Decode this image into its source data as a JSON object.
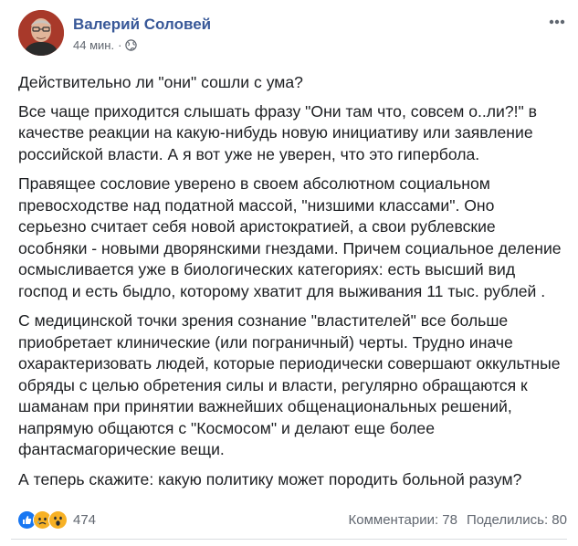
{
  "post": {
    "author": "Валерий Соловей",
    "timestamp": "44 мин.",
    "separator": "·",
    "paragraphs": [
      "Действительно ли \"они\" сошли с ума?",
      "Все чаще приходится слышать фразу \"Они там что, совсем о..ли?!\" в качестве реакции на какую-нибудь новую инициативу или заявление российской власти. А я вот уже не уверен, что это гипербола.",
      "Правящее сословие уверено в своем абсолютном социальном превосходстве над податной массой, \"низшими классами\". Оно серьезно считает себя новой аристократией, а свои рублевские особняки - новыми дворянскими гнездами. Причем социальное деление осмысливается уже в биологических категориях: есть высший вид господ и есть быдло, которому хватит для выживания 11 тыс. рублей .",
      "С медицинской точки зрения сознание \"властителей\" все больше приобретает клинические (или пограничный) черты. Трудно иначе охарактеризовать людей, которые периодически совершают оккультные обряды с целью обретения силы и власти, регулярно обращаются к шаманам при принятии важнейших общенациональных решений, напрямую общаются с \"Космосом\" и делают еще более фантасмагорические вещи.",
      "А теперь скажите: какую политику может породить больной разум?"
    ],
    "reactions": {
      "icons": [
        "like-icon",
        "sad-icon",
        "wow-icon"
      ],
      "count": "474"
    },
    "comments": "Комментарии: 78",
    "shares": "Поделились: 80"
  },
  "colors": {
    "author": "#385898",
    "meta": "#616770",
    "text": "#1c1e21",
    "like": "#1877f2",
    "emoji": "#f7b125"
  }
}
